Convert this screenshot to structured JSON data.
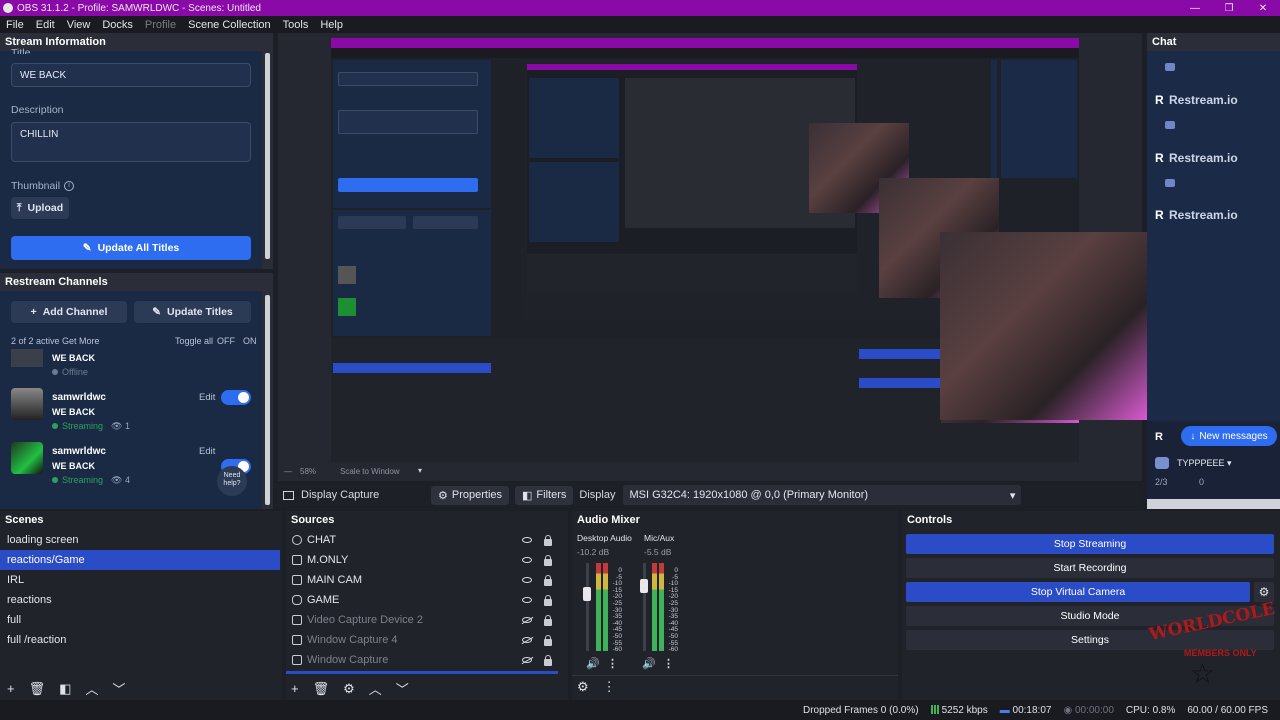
{
  "window": {
    "title": "OBS 31.1.2 - Profile: SAMWRLDWC - Scenes: Untitled",
    "controls": [
      "—",
      "❐",
      "✕"
    ]
  },
  "menu": [
    "File",
    "Edit",
    "View",
    "Docks",
    "Profile",
    "Scene Collection",
    "Tools",
    "Help"
  ],
  "stream_info": {
    "dock_title": "Stream Information",
    "title_label": "Title",
    "title_value": "WE BACK",
    "description_label": "Description",
    "description_value": "CHILLIN",
    "thumbnail_label": "Thumbnail",
    "upload_label": "Upload",
    "update_all_label": "Update All Titles"
  },
  "restream": {
    "dock_title": "Restream Channels",
    "add_channel": "Add Channel",
    "update_titles": "Update Titles",
    "active_text": "2 of 2 active Get More",
    "toggle_all_label": "Toggle all",
    "toggle_off": "OFF",
    "toggle_on": "ON",
    "channels": [
      {
        "name": "",
        "title": "WE BACK",
        "status": "Offline",
        "viewers": ""
      },
      {
        "name": "samwrldwc",
        "title": "WE BACK",
        "status": "Streaming",
        "viewers": "1",
        "edit": "Edit"
      },
      {
        "name": "samwrldwc",
        "title": "WE BACK",
        "status": "Streaming",
        "viewers": "4",
        "edit": "Edit"
      }
    ],
    "need_help": "Need help?"
  },
  "chat": {
    "dock_title": "Chat",
    "messages": [
      "Restream.io",
      "Restream.io",
      "Restream.io"
    ],
    "new_messages": "New messages",
    "user": "TYPPPEEE",
    "counter": "2/3",
    "zero": "0"
  },
  "preview_bar": {
    "zoom": "58%",
    "scale_mode": "Scale to Window"
  },
  "display_bar": {
    "source": "Display Capture",
    "properties": "Properties",
    "filters": "Filters",
    "display_label": "Display",
    "display_value": "MSI G32C4: 1920x1080 @ 0,0 (Primary Monitor)"
  },
  "scenes": {
    "dock_title": "Scenes",
    "items": [
      "loading screen",
      "reactions/Game",
      "IRL",
      "reactions",
      "full",
      "full /reaction"
    ],
    "selected": 1
  },
  "sources": {
    "dock_title": "Sources",
    "items": [
      {
        "name": "CHAT",
        "visible": true
      },
      {
        "name": "M.ONLY",
        "visible": true
      },
      {
        "name": "MAIN CAM",
        "visible": true
      },
      {
        "name": "GAME",
        "visible": true
      },
      {
        "name": "Video Capture Device 2",
        "visible": false
      },
      {
        "name": "Window Capture 4",
        "visible": false
      },
      {
        "name": "Window Capture",
        "visible": false
      }
    ]
  },
  "mixer": {
    "dock_title": "Audio Mixer",
    "channels": [
      {
        "name": "Desktop Audio",
        "db": "-10.2 dB"
      },
      {
        "name": "Mic/Aux",
        "db": "-5.5 dB"
      }
    ],
    "scale": [
      "0",
      "-5",
      "-10",
      "-15",
      "-20",
      "-25",
      "-30",
      "-35",
      "-40",
      "-45",
      "-50",
      "-55",
      "-60"
    ]
  },
  "controls": {
    "dock_title": "Controls",
    "stop_streaming": "Stop Streaming",
    "start_recording": "Start Recording",
    "stop_virtual_camera": "Stop Virtual Camera",
    "studio_mode": "Studio Mode",
    "settings": "Settings",
    "watermark_line1": "WORLDCOLE",
    "watermark_line2": "MEMBERS ONLY"
  },
  "status": {
    "dropped_frames": "Dropped Frames 0 (0.0%)",
    "bitrate": "5252 kbps",
    "stream_time": "00:18:07",
    "record_time": "00:00:00",
    "cpu": "CPU: 0.8%",
    "fps": "60.00 / 60.00 FPS"
  },
  "colors": {
    "accent": "#2b4cc7",
    "titlebar": "#8a0aa8",
    "restream_panel": "#1a2a45"
  }
}
